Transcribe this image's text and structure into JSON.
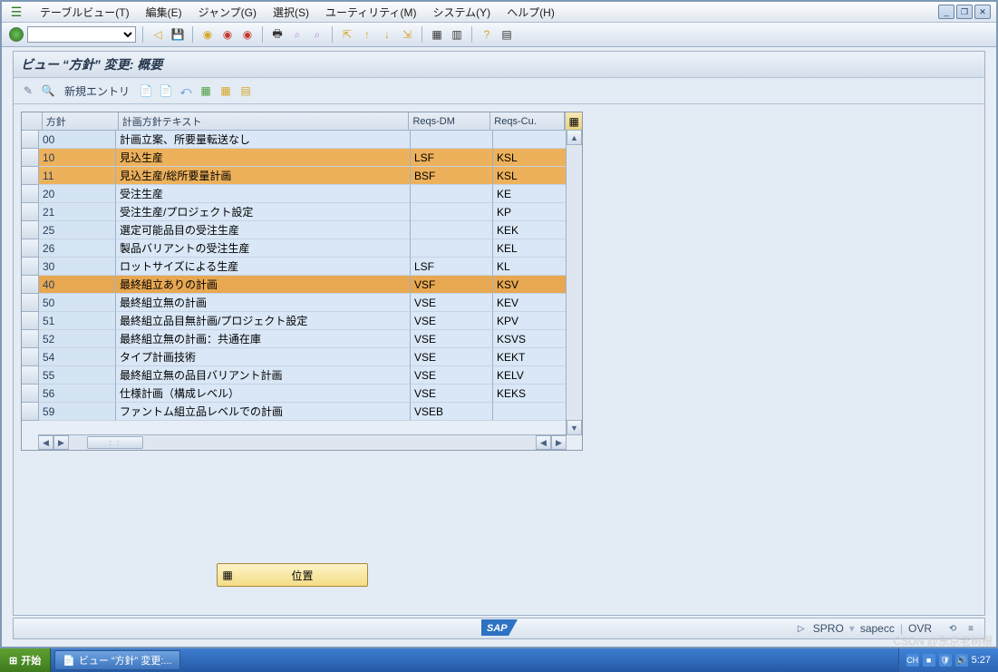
{
  "menu": {
    "items": [
      "テーブルビュー(T)",
      "編集(E)",
      "ジャンプ(G)",
      "選択(S)",
      "ユーティリティ(M)",
      "システム(Y)",
      "ヘルプ(H)"
    ]
  },
  "win": {
    "min": "_",
    "max": "❐",
    "close": "✕"
  },
  "header": {
    "title": "ビュー “方針” 変更: 概要"
  },
  "apptb": {
    "newentry": "新規エントリ"
  },
  "columns": {
    "sel": "",
    "c1": "方針",
    "c2": "計画方針テキスト",
    "c3": "Reqs-DM",
    "c4": "Reqs-Cu."
  },
  "rows": [
    {
      "c1": "00",
      "c2": "計画立案、所要量転送なし",
      "c3": "",
      "c4": ""
    },
    {
      "c1": "10",
      "c2": "見込生産",
      "c3": "LSF",
      "c4": "KSL",
      "hl": 1
    },
    {
      "c1": "11",
      "c2": "見込生産/総所要量計画",
      "c3": "BSF",
      "c4": "KSL",
      "hl": 1
    },
    {
      "c1": "20",
      "c2": "受注生産",
      "c3": "",
      "c4": "KE"
    },
    {
      "c1": "21",
      "c2": "受注生産/プロジェクト設定",
      "c3": "",
      "c4": "KP"
    },
    {
      "c1": "25",
      "c2": "選定可能品目の受注生産",
      "c3": "",
      "c4": "KEK"
    },
    {
      "c1": "26",
      "c2": "製品バリアントの受注生産",
      "c3": "",
      "c4": "KEL"
    },
    {
      "c1": "30",
      "c2": "ロットサイズによる生産",
      "c3": "LSF",
      "c4": "KL"
    },
    {
      "c1": "40",
      "c2": "最終組立ありの計画",
      "c3": "VSF",
      "c4": "KSV",
      "hl": 2
    },
    {
      "c1": "50",
      "c2": "最終組立無の計画",
      "c3": "VSE",
      "c4": "KEV"
    },
    {
      "c1": "51",
      "c2": "最終組立品目無計画/プロジェクト設定",
      "c3": "VSE",
      "c4": "KPV"
    },
    {
      "c1": "52",
      "c2": "最終組立無の計画：共通在庫",
      "c3": "VSE",
      "c4": "KSVS"
    },
    {
      "c1": "54",
      "c2": "タイプ計画技術",
      "c3": "VSE",
      "c4": "KEKT"
    },
    {
      "c1": "55",
      "c2": "最終組立無の品目バリアント計画",
      "c3": "VSE",
      "c4": "KELV"
    },
    {
      "c1": "56",
      "c2": "仕様計画（構成レベル）",
      "c3": "VSE",
      "c4": "KEKS"
    },
    {
      "c1": "59",
      "c2": "ファントム組立品レベルでの計画",
      "c3": "VSEB",
      "c4": ""
    }
  ],
  "posbtn": "位置",
  "status": {
    "logo": "SAP",
    "tcode": "SPRO",
    "sys": "sapecc",
    "mode": "OVR"
  },
  "taskbar": {
    "start": "开始",
    "item": "ビュー “方針” 変更:...",
    "ime": "CH",
    "time": "5:27",
    "watermark": "CSDN @东京老树根"
  }
}
